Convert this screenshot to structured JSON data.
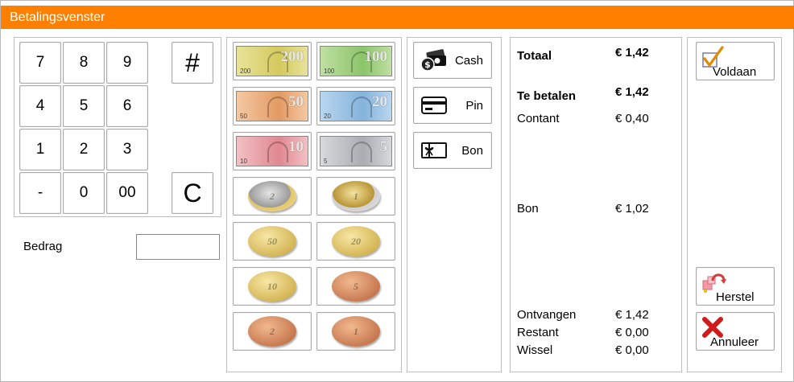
{
  "window": {
    "title": "Betalingsvenster"
  },
  "keypad": {
    "keys": [
      "7",
      "8",
      "9",
      "4",
      "5",
      "6",
      "1",
      "2",
      "3",
      "-",
      "0",
      "00"
    ],
    "hash_label": "#",
    "clear_label": "C"
  },
  "amount": {
    "label": "Bedrag",
    "value": ""
  },
  "notes": [
    {
      "value": "200",
      "colors": [
        "#e8e39a",
        "#d4c95e"
      ]
    },
    {
      "value": "100",
      "colors": [
        "#bfe0a2",
        "#8cc46a"
      ]
    },
    {
      "value": "50",
      "colors": [
        "#f4c9a3",
        "#e39a63"
      ]
    },
    {
      "value": "20",
      "colors": [
        "#b9d6ef",
        "#84b3dc"
      ]
    },
    {
      "value": "10",
      "colors": [
        "#f2c1c4",
        "#e0888f"
      ]
    },
    {
      "value": "5",
      "colors": [
        "#d7d9dc",
        "#a9adb2"
      ]
    }
  ],
  "coins": [
    {
      "value": "2",
      "type": "bimetal-silver"
    },
    {
      "value": "1",
      "type": "bimetal-gold"
    },
    {
      "value": "50",
      "type": "gold"
    },
    {
      "value": "20",
      "type": "gold"
    },
    {
      "value": "10",
      "type": "gold"
    },
    {
      "value": "5",
      "type": "copper"
    },
    {
      "value": "2",
      "type": "copper"
    },
    {
      "value": "1",
      "type": "copper"
    }
  ],
  "payment_methods": [
    {
      "label": "Cash",
      "icon": "cash-icon"
    },
    {
      "label": "Pin",
      "icon": "card-icon"
    },
    {
      "label": "Bon",
      "icon": "voucher-icon"
    }
  ],
  "summary": {
    "totaal": {
      "label": "Totaal",
      "value": "€ 1,42"
    },
    "te_betalen": {
      "label": "Te betalen",
      "value": "€ 1,42"
    },
    "contant": {
      "label": "Contant",
      "value": "€ 0,40"
    },
    "bon": {
      "label": "Bon",
      "value": "€ 1,02"
    },
    "ontvangen": {
      "label": "Ontvangen",
      "value": "€ 1,42"
    },
    "restant": {
      "label": "Restant",
      "value": "€ 0,00"
    },
    "wissel": {
      "label": "Wissel",
      "value": "€ 0,00"
    }
  },
  "actions": {
    "voldaan": {
      "label": "Voldaan",
      "icon": "checkmark-icon"
    },
    "herstel": {
      "label": "Herstel",
      "icon": "undo-icon"
    },
    "annuleer": {
      "label": "Annuleer",
      "icon": "cross-icon"
    }
  },
  "colors": {
    "titlebar": "#ff8000",
    "titletext": "#ffffff",
    "border": "#bdbdbd"
  }
}
